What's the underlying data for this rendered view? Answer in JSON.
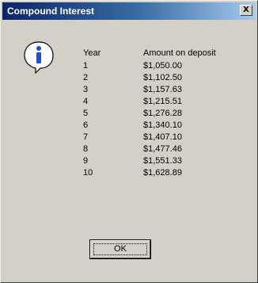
{
  "window": {
    "title": "Compound Interest",
    "close_label": "X"
  },
  "icon": {
    "name": "info-icon",
    "glyph": "i"
  },
  "table": {
    "header_year": "Year",
    "header_amount": "Amount on deposit",
    "rows": [
      {
        "year": "1",
        "amount": "$1,050.00"
      },
      {
        "year": "2",
        "amount": "$1,102.50"
      },
      {
        "year": "3",
        "amount": "$1,157.63"
      },
      {
        "year": "4",
        "amount": "$1,215.51"
      },
      {
        "year": "5",
        "amount": "$1,276.28"
      },
      {
        "year": "6",
        "amount": "$1,340.10"
      },
      {
        "year": "7",
        "amount": "$1,407.10"
      },
      {
        "year": "8",
        "amount": "$1,477.46"
      },
      {
        "year": "9",
        "amount": "$1,551.33"
      },
      {
        "year": "10",
        "amount": "$1,628.89"
      }
    ]
  },
  "buttons": {
    "ok_label": "OK"
  },
  "colors": {
    "titlebar_start": "#0a246a",
    "titlebar_end": "#a6caf0",
    "dialog_bg": "#d4d0c8",
    "icon_blue": "#1f4fcf"
  }
}
